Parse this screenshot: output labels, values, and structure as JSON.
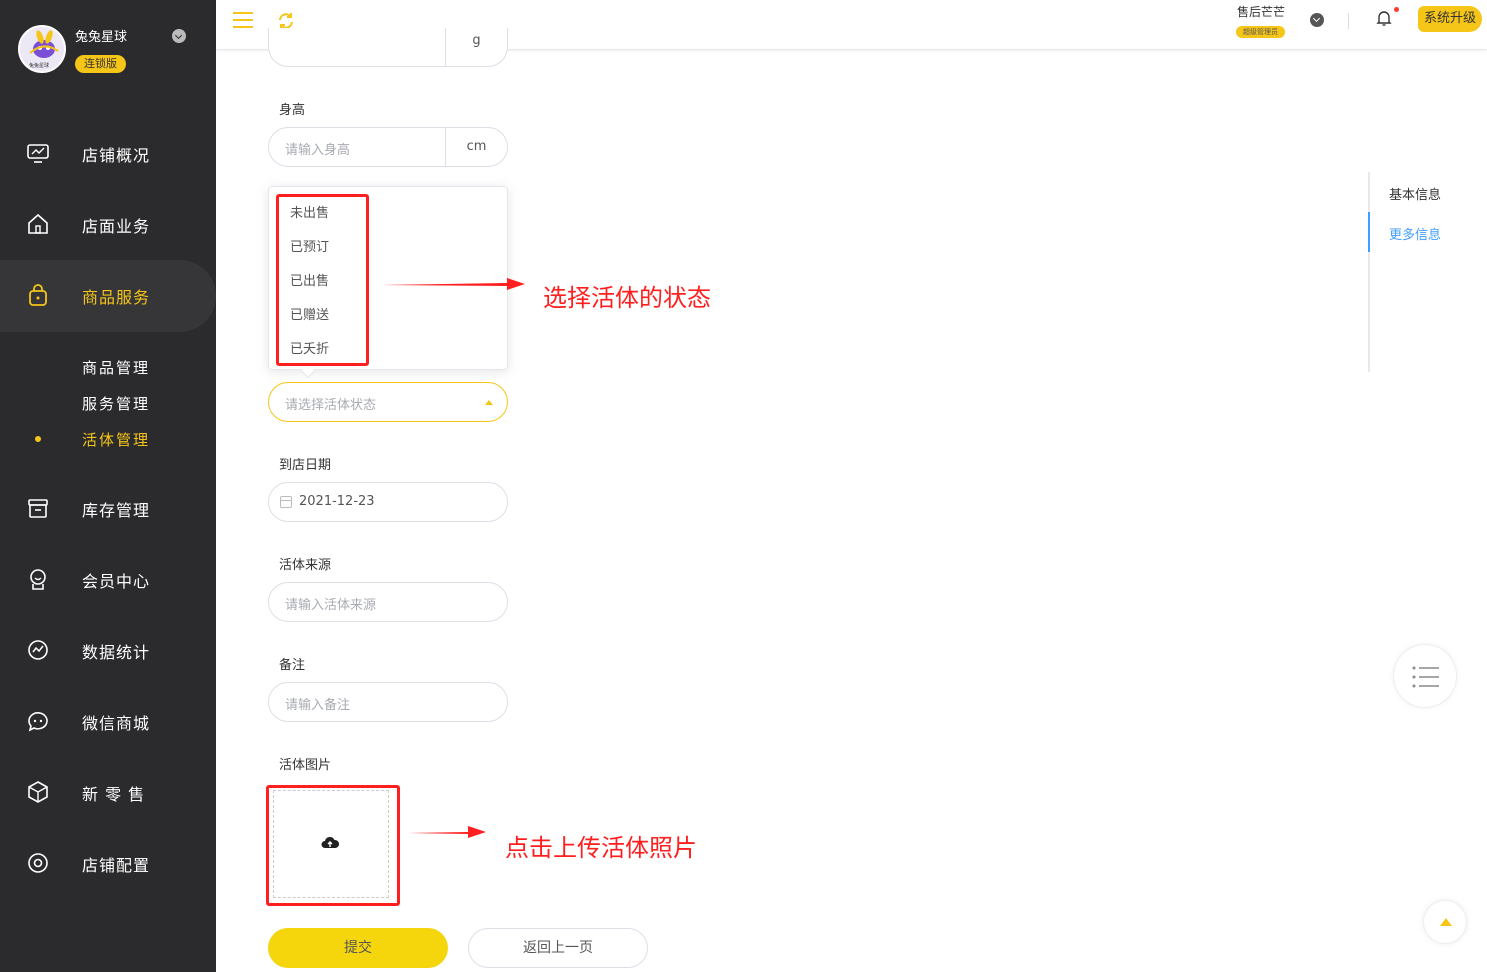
{
  "brand": {
    "name": "兔兔星球",
    "edition": "连锁版",
    "logo_caption": "兔兔星球"
  },
  "nav": {
    "items": [
      {
        "label": "店铺概况",
        "icon": "monitor-icon"
      },
      {
        "label": "店面业务",
        "icon": "home-icon"
      },
      {
        "label": "商品服务",
        "icon": "bag-icon",
        "active": true
      },
      {
        "label": "库存管理",
        "icon": "archive-icon"
      },
      {
        "label": "会员中心",
        "icon": "member-icon"
      },
      {
        "label": "数据统计",
        "icon": "chart-icon"
      },
      {
        "label": "微信商城",
        "icon": "chat-icon"
      },
      {
        "label": "新 零 售",
        "icon": "box-icon"
      },
      {
        "label": "店铺配置",
        "icon": "settings-icon"
      }
    ],
    "sub_items": [
      {
        "label": "商品管理"
      },
      {
        "label": "服务管理"
      },
      {
        "label": "活体管理",
        "active": true
      }
    ]
  },
  "topbar": {
    "user_name": "售后芒芒",
    "user_role": "超级管理员",
    "upgrade_label": "系统升级"
  },
  "form": {
    "weight_unit": "g",
    "height": {
      "label": "身高",
      "placeholder": "请输入身高",
      "unit": "cm"
    },
    "status": {
      "placeholder": "请选择活体状态",
      "options": [
        "未出售",
        "已预订",
        "已出售",
        "已赠送",
        "已夭折"
      ]
    },
    "arrival_date": {
      "label": "到店日期",
      "value": "2021-12-23"
    },
    "source": {
      "label": "活体来源",
      "placeholder": "请输入活体来源"
    },
    "remark": {
      "label": "备注",
      "placeholder": "请输入备注"
    },
    "photo": {
      "label": "活体图片"
    },
    "submit_label": "提交",
    "back_label": "返回上一页"
  },
  "anchors": [
    {
      "label": "基本信息"
    },
    {
      "label": "更多信息",
      "active": true
    }
  ],
  "annotations": {
    "status_note": "选择活体的状态",
    "upload_note": "点击上传活体照片"
  },
  "colors": {
    "accent": "#f5c518",
    "sidebar": "#2b2b2e",
    "link": "#409eff",
    "annotation": "#ff1f1f"
  }
}
